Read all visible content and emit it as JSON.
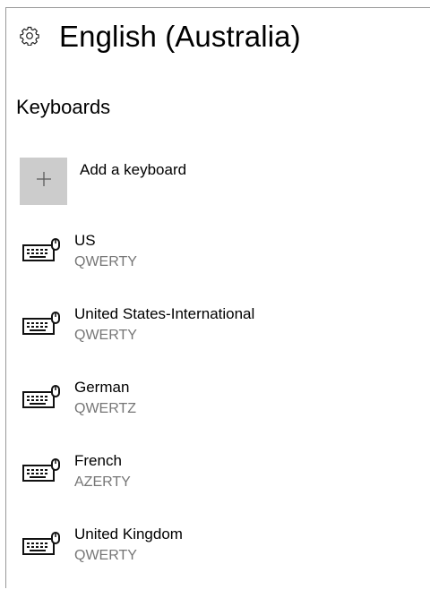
{
  "header": {
    "title": "English (Australia)",
    "icon": "gear-icon"
  },
  "section": {
    "title": "Keyboards"
  },
  "add_keyboard": {
    "label": "Add a keyboard",
    "icon": "plus-icon",
    "bg_color": "#cccccc"
  },
  "keyboards": [
    {
      "name": "US",
      "layout": "QWERTY"
    },
    {
      "name": "United States-International",
      "layout": "QWERTY"
    },
    {
      "name": "German",
      "layout": "QWERTZ"
    },
    {
      "name": "French",
      "layout": "AZERTY"
    },
    {
      "name": "United Kingdom",
      "layout": "QWERTY"
    }
  ],
  "colors": {
    "secondary_text": "#767676",
    "frame_border": "#9a9a9a"
  }
}
